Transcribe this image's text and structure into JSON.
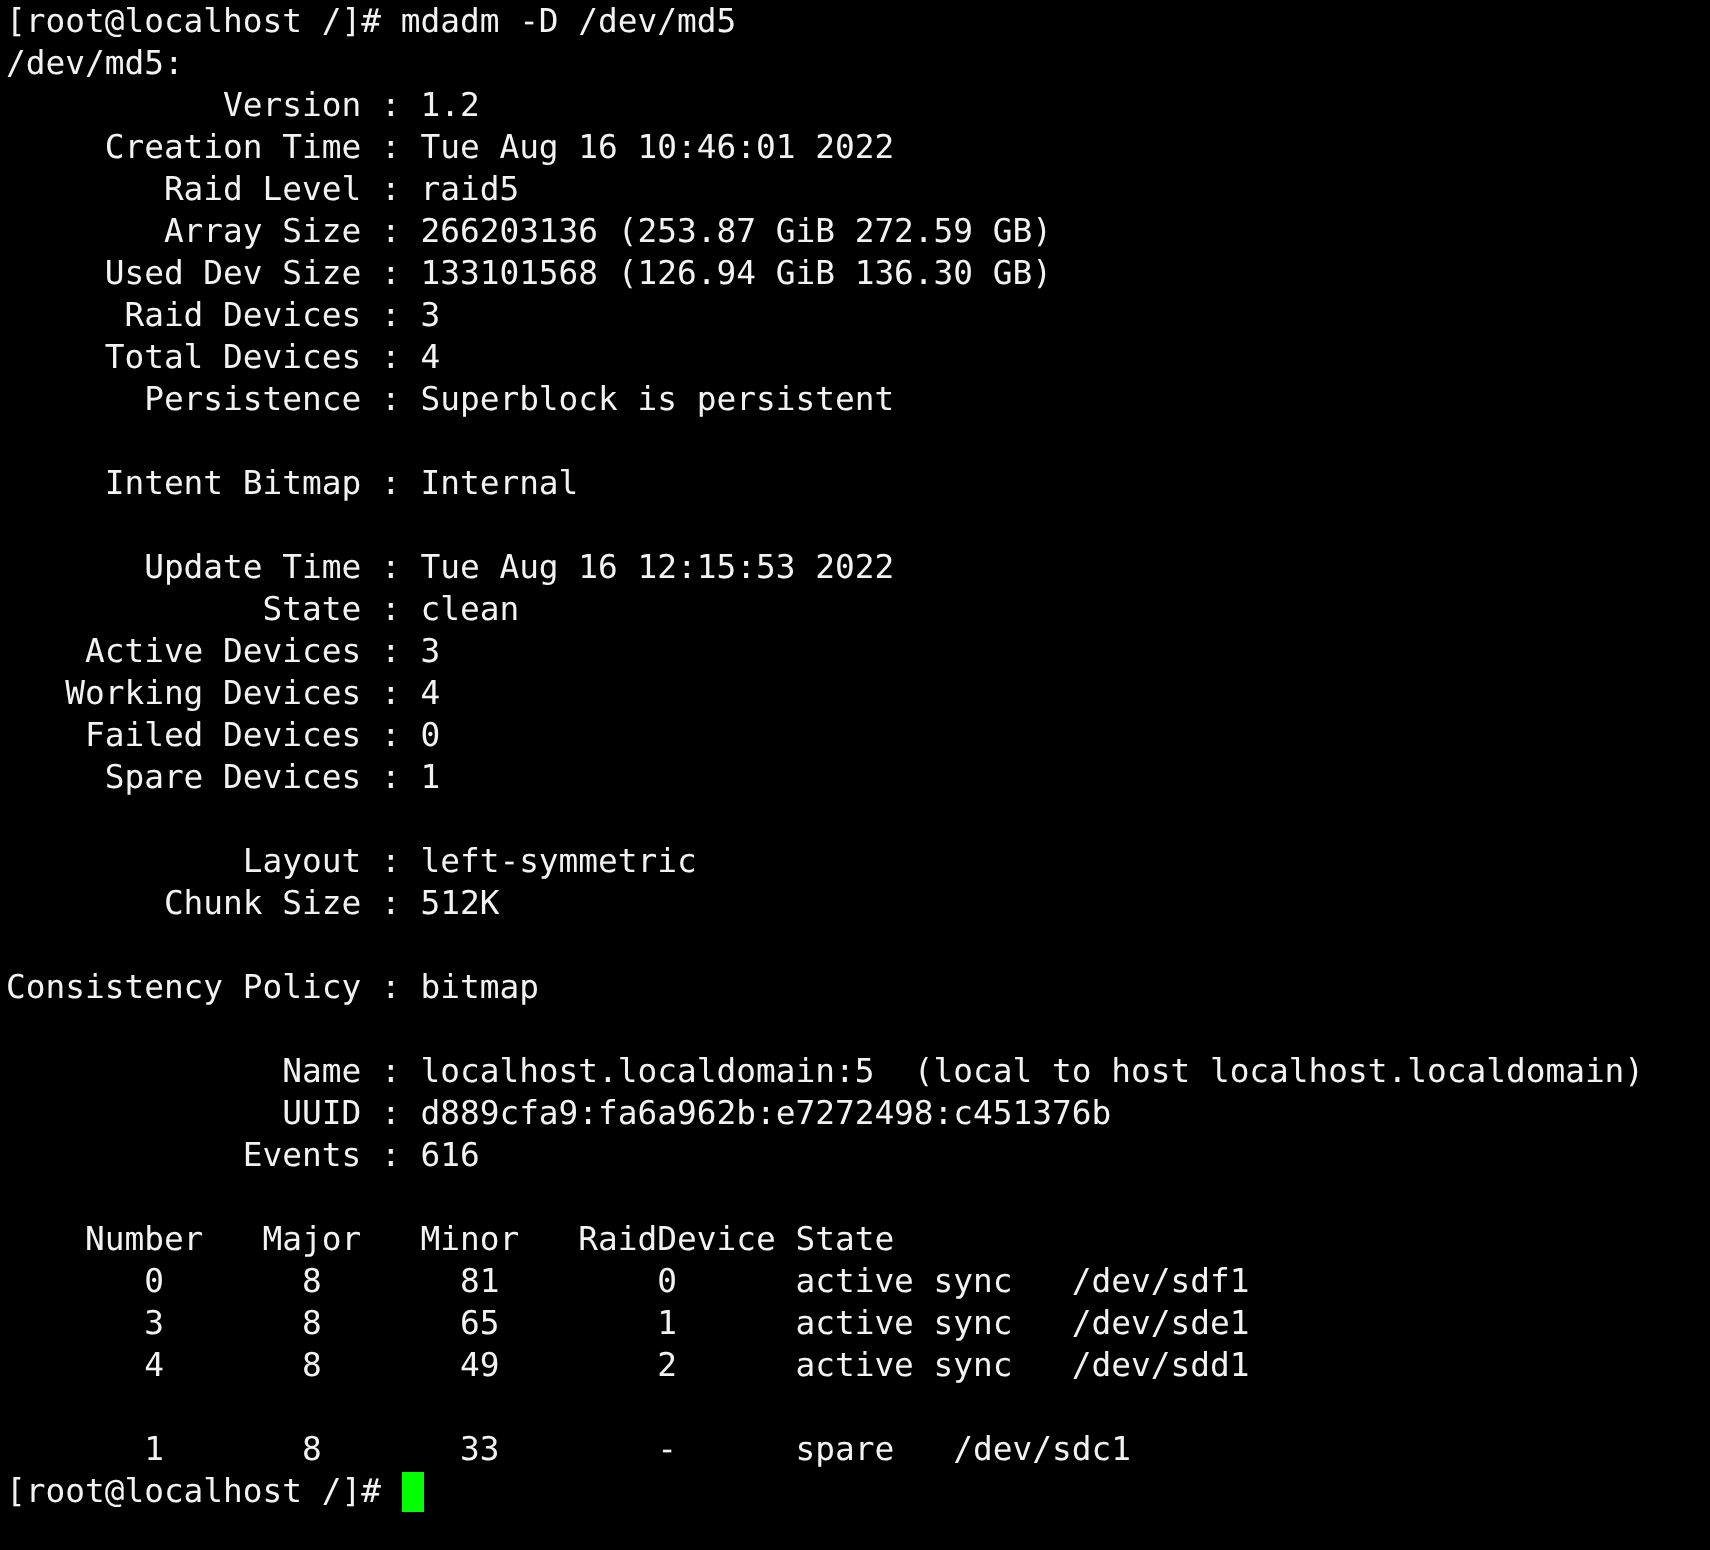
{
  "terminal": {
    "lines": [
      {
        "kind": "text",
        "text": "[root@localhost /]# mdadm -D /dev/md5"
      },
      {
        "kind": "text",
        "text": "/dev/md5:"
      },
      {
        "kind": "text",
        "text": "           Version : 1.2"
      },
      {
        "kind": "text",
        "text": "     Creation Time : Tue Aug 16 10:46:01 2022"
      },
      {
        "kind": "text",
        "text": "        Raid Level : raid5"
      },
      {
        "kind": "text",
        "text": "        Array Size : 266203136 (253.87 GiB 272.59 GB)"
      },
      {
        "kind": "text",
        "text": "     Used Dev Size : 133101568 (126.94 GiB 136.30 GB)"
      },
      {
        "kind": "text",
        "text": "      Raid Devices : 3"
      },
      {
        "kind": "text",
        "text": "     Total Devices : 4"
      },
      {
        "kind": "text",
        "text": "       Persistence : Superblock is persistent"
      },
      {
        "kind": "blank"
      },
      {
        "kind": "text",
        "text": "     Intent Bitmap : Internal"
      },
      {
        "kind": "blank"
      },
      {
        "kind": "text",
        "text": "       Update Time : Tue Aug 16 12:15:53 2022"
      },
      {
        "kind": "text",
        "text": "             State : clean"
      },
      {
        "kind": "text",
        "text": "    Active Devices : 3"
      },
      {
        "kind": "text",
        "text": "   Working Devices : 4"
      },
      {
        "kind": "text",
        "text": "    Failed Devices : 0"
      },
      {
        "kind": "text",
        "text": "     Spare Devices : 1"
      },
      {
        "kind": "blank"
      },
      {
        "kind": "text",
        "text": "            Layout : left-symmetric"
      },
      {
        "kind": "text",
        "text": "        Chunk Size : 512K"
      },
      {
        "kind": "blank"
      },
      {
        "kind": "text",
        "text": "Consistency Policy : bitmap"
      },
      {
        "kind": "blank"
      },
      {
        "kind": "text",
        "text": "              Name : localhost.localdomain:5  (local to host localhost.localdomain)"
      },
      {
        "kind": "text",
        "text": "              UUID : d889cfa9:fa6a962b:e7272498:c451376b"
      },
      {
        "kind": "text",
        "text": "            Events : 616"
      },
      {
        "kind": "blank"
      },
      {
        "kind": "text",
        "text": "    Number   Major   Minor   RaidDevice State"
      },
      {
        "kind": "text",
        "text": "       0       8       81        0      active sync   /dev/sdf1"
      },
      {
        "kind": "text",
        "text": "       3       8       65        1      active sync   /dev/sde1"
      },
      {
        "kind": "text",
        "text": "       4       8       49        2      active sync   /dev/sdd1"
      },
      {
        "kind": "blank"
      },
      {
        "kind": "text",
        "text": "       1       8       33        -      spare   /dev/sdc1"
      },
      {
        "kind": "prompt",
        "text": "[root@localhost /]#",
        "cursor": true
      }
    ]
  }
}
